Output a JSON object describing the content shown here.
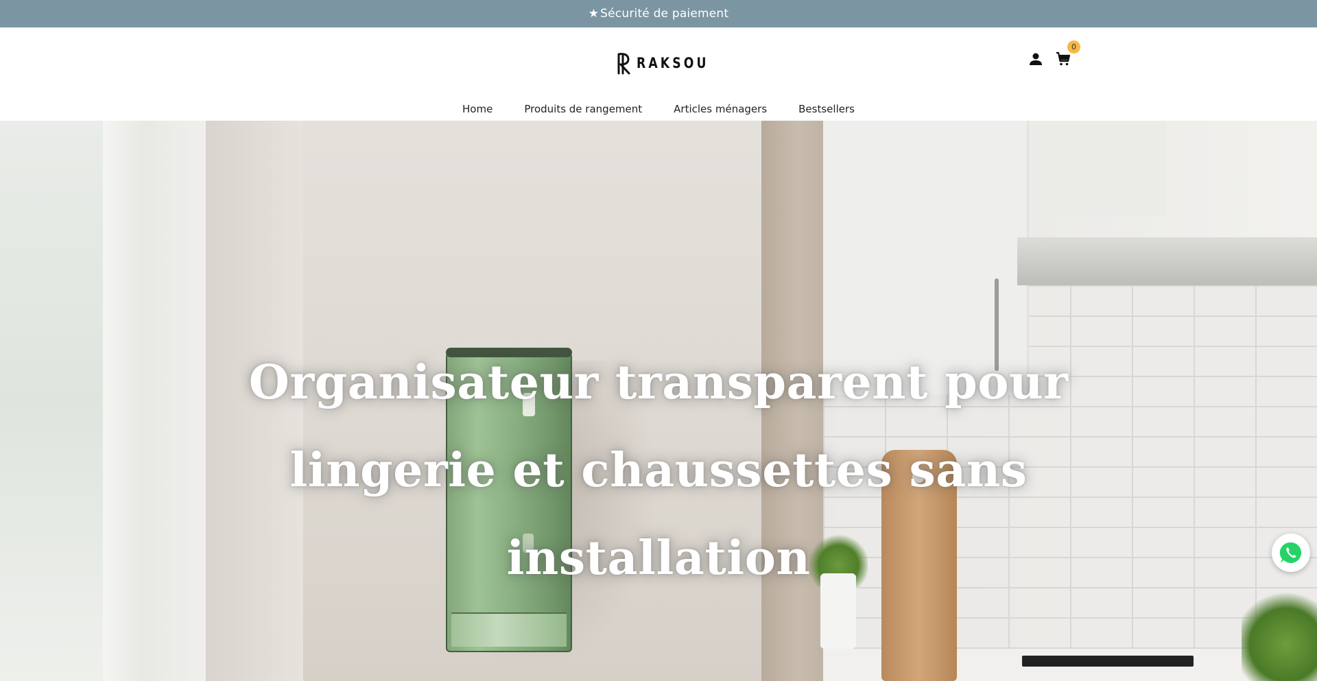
{
  "announcement": {
    "icon": "star-icon",
    "text": "Sécurité de paiement",
    "background_color": "#7c95a2"
  },
  "header": {
    "logo_text": "RAKSOU",
    "icons": {
      "account": "user-icon",
      "cart": "cart-icon"
    },
    "cart_count": "0",
    "badge_color": "#f7b844"
  },
  "nav": {
    "items": [
      {
        "label": "Home"
      },
      {
        "label": "Produits de rangement"
      },
      {
        "label": "Articles ménagers"
      },
      {
        "label": "Bestsellers"
      }
    ]
  },
  "hero": {
    "title": "Organisateur transparent pour lingerie et chaussettes sans installation"
  },
  "floating": {
    "whatsapp_icon": "whatsapp-icon",
    "whatsapp_color": "#25d366"
  }
}
